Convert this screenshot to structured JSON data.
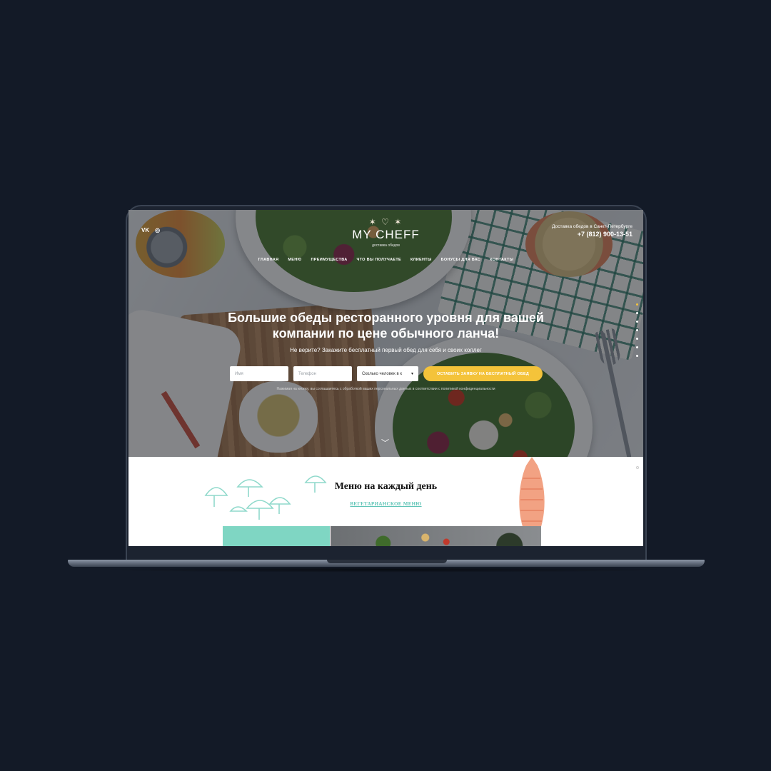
{
  "social": {
    "vk": "VK",
    "instagram": "◎"
  },
  "logo": {
    "mark": "✶ ♡ ✶",
    "name": "MY CHEFF",
    "tagline": "доставка обедов"
  },
  "contact": {
    "city": "Доставка обедов в Санкт-Петербурге",
    "phone": "+7 (812) 900-13-51"
  },
  "nav": [
    "ГЛАВНАЯ",
    "МЕНЮ",
    "ПРЕИМУЩЕСТВА",
    "ЧТО ВЫ ПОЛУЧАЕТЕ",
    "КЛИЕНТЫ",
    "БОНУСЫ ДЛЯ ВАС",
    "КОНТАКТЫ"
  ],
  "hero": {
    "title_line1": "Большие обеды ресторанного уровня для вашей",
    "title_line2": "компании по цене обычного ланча!",
    "subtitle": "Не верите? Закажите бесплатный первый обед для себя и своих коллег"
  },
  "form": {
    "name_placeholder": "Имя",
    "phone_placeholder": "Телефон",
    "people_value": "Сколько человек в к",
    "cta_label": "ОСТАВИТЬ ЗАЯВКУ НА БЕСПЛАТНЫЙ ОБЕД",
    "disclaimer": "Нажимая на кнопку, вы соглашаетесь с обработкой ваших персональных данных в соответствии с политикой конфиденциальности"
  },
  "menu": {
    "title": "Меню на каждый день",
    "link": "ВЕГЕТАРИАНСКОЕ МЕНЮ"
  },
  "colors": {
    "accent": "#f4c33a",
    "teal": "#5fc4b6",
    "background": "#131a27"
  }
}
